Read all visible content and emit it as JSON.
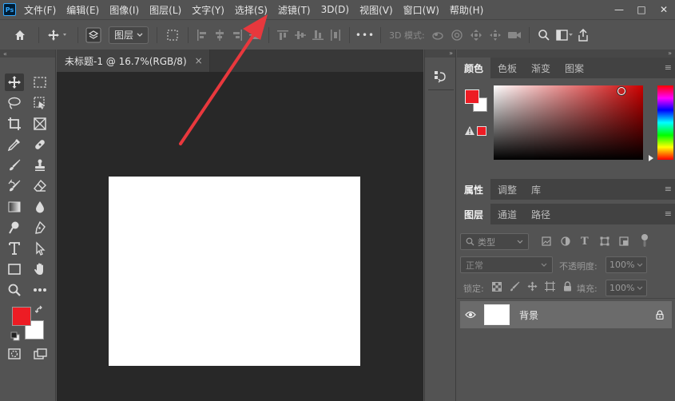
{
  "app": {
    "logo": "Ps"
  },
  "menu": {
    "items": [
      "文件(F)",
      "编辑(E)",
      "图像(I)",
      "图层(L)",
      "文字(Y)",
      "选择(S)",
      "滤镜(T)",
      "3D(D)",
      "视图(V)",
      "窗口(W)",
      "帮助(H)"
    ]
  },
  "window_controls": {
    "minimize": "—",
    "maximize": "□",
    "close": "✕"
  },
  "options_bar": {
    "layer_select": "图层",
    "more": "•••",
    "mode_3d_label": "3D 模式:"
  },
  "document": {
    "tab_title": "未标题-1 @ 16.7%(RGB/8)",
    "close": "×"
  },
  "color_panel": {
    "tabs": [
      "颜色",
      "色板",
      "渐变",
      "图案"
    ],
    "active_tab": "颜色",
    "foreground": "#ed1c24",
    "background": "#ffffff",
    "hue_color": "#cc0000"
  },
  "properties_panel": {
    "tabs": [
      "属性",
      "调整",
      "库"
    ],
    "active_tab": "属性"
  },
  "layers_panel": {
    "tabs": [
      "图层",
      "通道",
      "路径"
    ],
    "active_tab": "图层",
    "filter_label": "类型",
    "blend_mode": "正常",
    "opacity_label": "不透明度:",
    "opacity_value": "100%",
    "lock_label": "锁定:",
    "fill_label": "填充:",
    "fill_value": "100%",
    "layers": [
      {
        "name": "背景",
        "locked": true,
        "visible": true
      }
    ]
  },
  "colors": {
    "accent_red": "#e8383d",
    "arrow_red": "#e8383d"
  }
}
